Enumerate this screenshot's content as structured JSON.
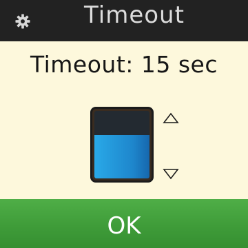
{
  "header": {
    "icon": "gear-icon",
    "title": "Timeout"
  },
  "main": {
    "status_text": "Timeout: 15 sec",
    "level_fraction": 0.64,
    "increase_icon": "triangle-up-icon",
    "decrease_icon": "triangle-down-icon"
  },
  "footer": {
    "ok_label": "OK"
  },
  "colors": {
    "header_bg": "#222222",
    "body_bg": "#fdf8dc",
    "accent_blue": "#1e86cc",
    "ok_green": "#3f9c39"
  }
}
